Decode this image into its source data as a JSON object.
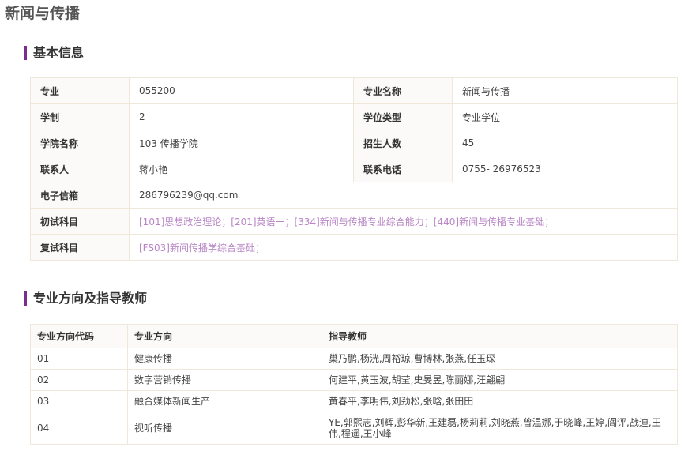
{
  "page_title": "新闻与传播",
  "basic": {
    "heading": "基本信息",
    "rows": [
      [
        {
          "label": "专业",
          "value": "055200"
        },
        {
          "label": "专业名称",
          "value": "新闻与传播"
        }
      ],
      [
        {
          "label": "学制",
          "value": "2"
        },
        {
          "label": "学位类型",
          "value": "专业学位"
        }
      ],
      [
        {
          "label": "学院名称",
          "value": "103 传播学院"
        },
        {
          "label": "招生人数",
          "value": "45"
        }
      ],
      [
        {
          "label": "联系人",
          "value": "蒋小艳"
        },
        {
          "label": "联系电话",
          "value": "0755- 26976523"
        }
      ]
    ],
    "email": {
      "label": "电子信箱",
      "value": "286796239@qq.com"
    },
    "prelim": {
      "label": "初试科目",
      "value": "[101]思想政治理论；[201]英语一；[334]新闻与传播专业综合能力；[440]新闻与传播专业基础；"
    },
    "retest": {
      "label": "复试科目",
      "value": "[FS03]新闻传播学综合基础；"
    }
  },
  "directions": {
    "heading": "专业方向及指导教师",
    "columns": [
      "专业方向代码",
      "专业方向",
      "指导教师"
    ],
    "rows": [
      [
        "01",
        "健康传播",
        "巢乃鹏,杨洸,周裕琼,曹博林,张燕,任玉琛"
      ],
      [
        "02",
        "数字营销传播",
        "何建平,黄玉波,胡莹,史旻昱,陈丽娜,汪翩翩"
      ],
      [
        "03",
        "融合媒体新闻生产",
        "黄春平,李明伟,刘劲松,张晗,张田田"
      ],
      [
        "04",
        "视听传播",
        "YE,郭熙志,刘辉,彭华新,王建磊,杨莉莉,刘晓燕,曾温娜,于晓峰,王婷,阎评,战迪,王伟,程遥,王小峰"
      ]
    ]
  }
}
